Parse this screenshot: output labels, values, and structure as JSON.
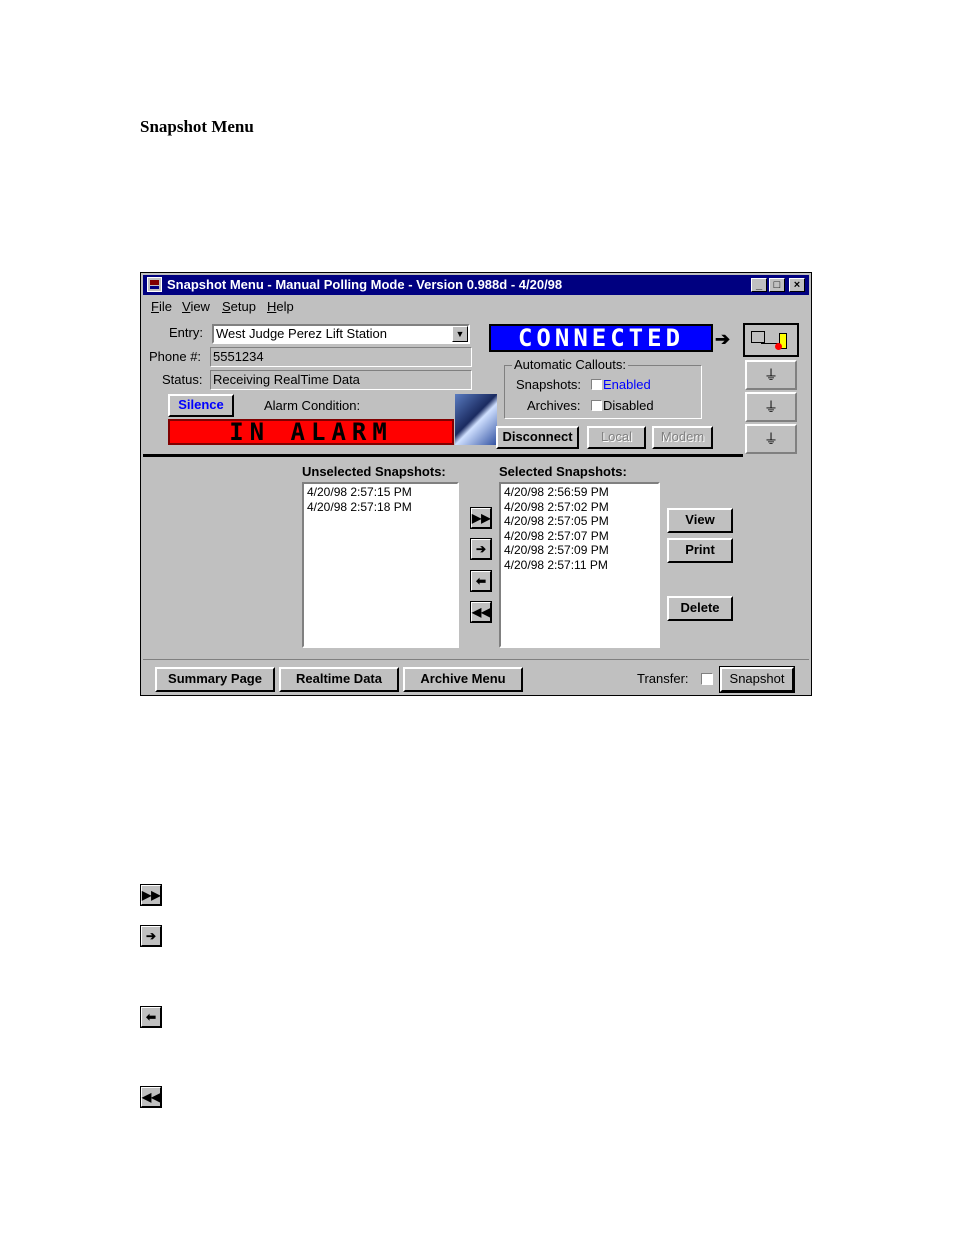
{
  "doc": {
    "heading": "Snapshot Menu"
  },
  "window": {
    "title": "Snapshot Menu - Manual Polling Mode - Version 0.988d - 4/20/98",
    "minimize": "_",
    "maximize": "□",
    "close": "×"
  },
  "menu": {
    "file": "File",
    "view": "View",
    "setup": "Setup",
    "help": "Help"
  },
  "header": {
    "entry_label": "Entry:",
    "entry_value": "West Judge Perez Lift Station",
    "phone_label": "Phone #:",
    "phone_value": "5551234",
    "status_label": "Status:",
    "status_value": "Receiving RealTime Data",
    "silence": "Silence",
    "alarm_condition_label": "Alarm Condition:",
    "alarm_text": "IN ALARM",
    "connected_text": "CONNECTED",
    "callouts": {
      "title": "Automatic Callouts:",
      "snapshots_label": "Snapshots:",
      "snapshots_value": "Enabled",
      "archives_label": "Archives:",
      "archives_value": "Disabled"
    },
    "disconnect": "Disconnect",
    "local": "Local",
    "modem": "Modem"
  },
  "lists": {
    "unselected_title": "Unselected Snapshots:",
    "unselected": [
      "4/20/98 2:57:15 PM",
      "4/20/98 2:57:18 PM"
    ],
    "selected_title": "Selected Snapshots:",
    "selected": [
      "4/20/98 2:56:59 PM",
      "4/20/98 2:57:02 PM",
      "4/20/98 2:57:05 PM",
      "4/20/98 2:57:07 PM",
      "4/20/98 2:57:09 PM",
      "4/20/98 2:57:11 PM"
    ]
  },
  "buttons": {
    "view": "View",
    "print": "Print",
    "delete": "Delete"
  },
  "footer": {
    "summary": "Summary Page",
    "realtime": "Realtime Data",
    "archive": "Archive Menu",
    "transfer_label": "Transfer:",
    "snapshot": "Snapshot"
  },
  "colors": {
    "title_bar": "#000080",
    "connected_bg": "#0000ff",
    "alarm_bg": "#ff0000",
    "enabled_text": "#0000ff"
  }
}
